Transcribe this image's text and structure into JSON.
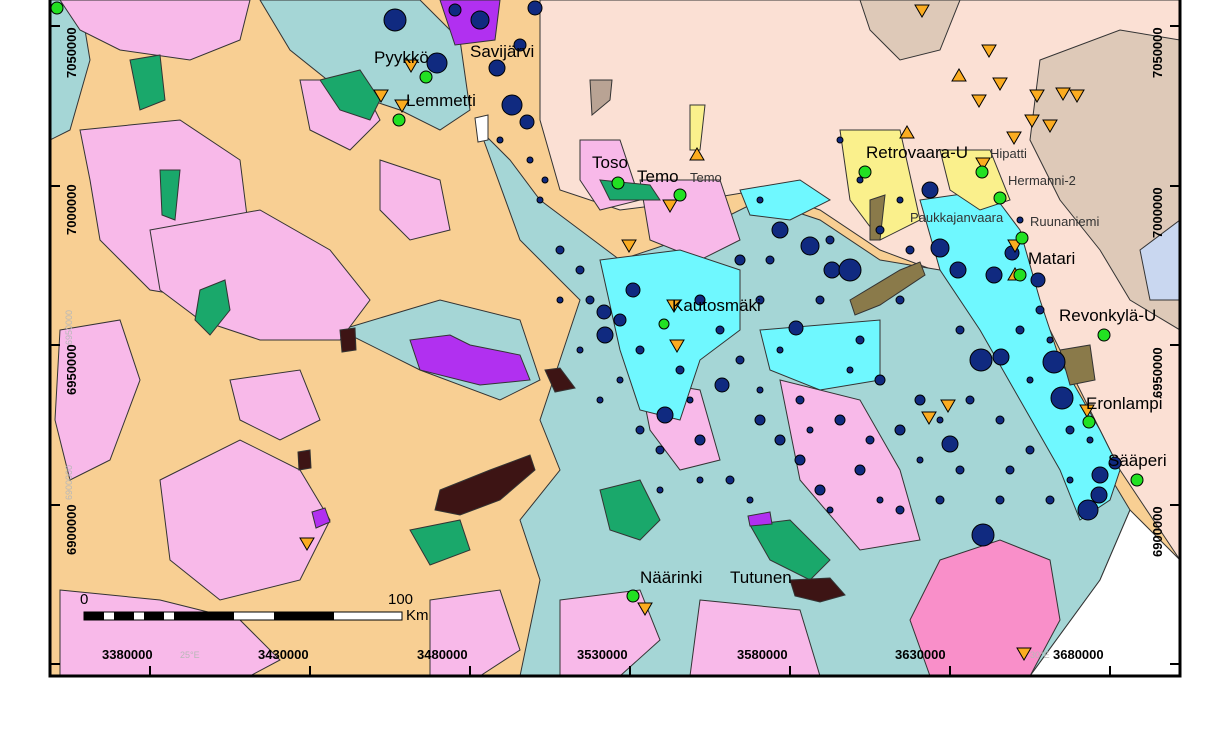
{
  "colors": {
    "granite": "#f8cf93",
    "pink_granitoid": "#f8b9e9",
    "supracrustal": "#a5d6d6",
    "pale_pink": "#fbe0d4",
    "brown_gneiss": "#dec9b8",
    "green_mafic": "#1aa86b",
    "purple": "#b130f0",
    "cyan": "#6ff8ff",
    "yellow": "#faf08c",
    "dark_brown": "#3d1414",
    "olive": "#8a7a4a",
    "navy_circle": "#102a80",
    "orange_triangle": "#fbac20",
    "green_dot": "#22e122",
    "hot_pink": "#f98fc9"
  },
  "place_names": [
    "Pyykkö",
    "Savijärvi",
    "Lemmetti",
    "Toso",
    "Temo",
    "Temo",
    "Retrovaara-U",
    "Hipatti",
    "Hermanni-2",
    "Paukkajanvaara",
    "Ruunaniemi",
    "Matari",
    "Kautosmäki",
    "Revonkylä-U",
    "Eronlampi",
    "Sääperi",
    "Näärinki",
    "Tutunen"
  ],
  "easting_labels": [
    "3380000",
    "3430000",
    "3480000",
    "3530000",
    "3580000",
    "3630000",
    "3680000"
  ],
  "northing_labels": [
    "7050000",
    "7000000",
    "6950000",
    "6900000"
  ],
  "left_northing_labels": [
    "7050000",
    "7000000",
    "6950000",
    "6900000"
  ],
  "faint_labels": [
    "25°E",
    "30°E",
    "6950000",
    "6900000"
  ],
  "scale_bar": {
    "start": "0",
    "end": "100",
    "unit": "Km"
  }
}
